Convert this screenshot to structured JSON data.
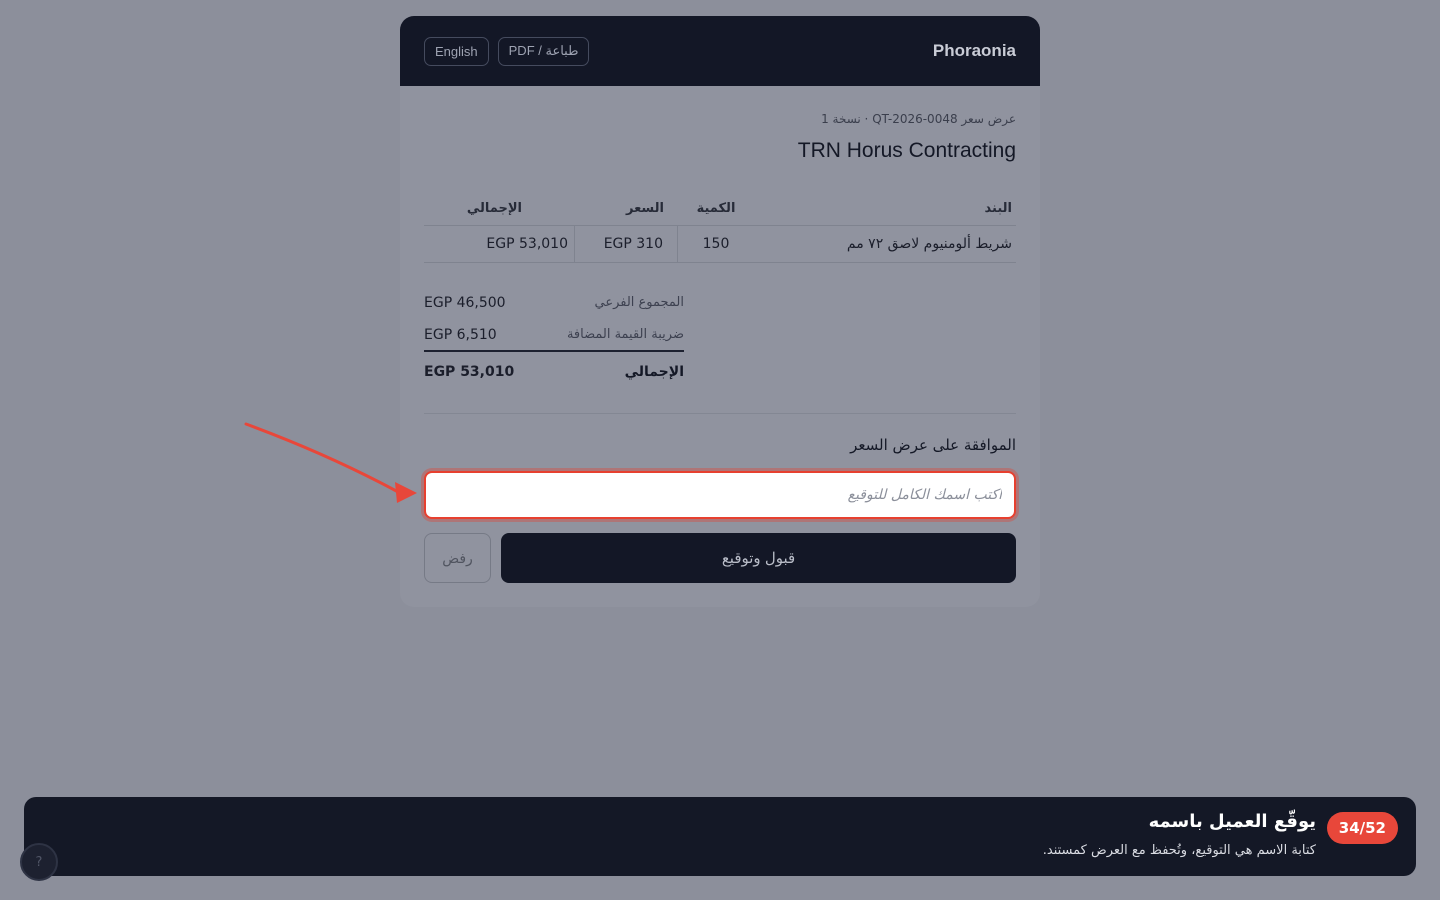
{
  "header": {
    "brand": "Phoraonia",
    "lang_button": "English",
    "print_button": "طباعة / PDF"
  },
  "quote": {
    "meta": "عرض سعر QT-2026-0048 · نسخة 1",
    "client_name": "TRN Horus Contracting"
  },
  "table": {
    "headers": {
      "item": "البند",
      "qty": "الكمية",
      "price": "السعر",
      "total": "الإجمالي"
    },
    "rows": [
      {
        "item": "شريط ألومنيوم لاصق ٧٢ مم",
        "qty": "150",
        "price": "EGP 310",
        "total": "EGP 53,010"
      }
    ]
  },
  "totals": {
    "subtotal_label": "المجموع الفرعي",
    "subtotal_value": "EGP 46,500",
    "vat_label": "ضريبة القيمة المضافة",
    "vat_value": "EGP 6,510",
    "grand_label": "الإجمالي",
    "grand_value": "EGP 53,010"
  },
  "acceptance": {
    "title": "الموافقة على عرض السعر",
    "signature_placeholder": "اكتب اسمك الكامل للتوقيع",
    "accept_button": "قبول وتوقيع",
    "reject_button": "رفض"
  },
  "tour": {
    "step": "34/52",
    "title": "يوقّع العميل باسمه",
    "description": "كتابة الاسم هي التوقيع، وتُحفظ مع العرض كمستند."
  },
  "colors": {
    "dark": "#131726",
    "highlight": "#e7402f",
    "badge": "#e8473a"
  }
}
